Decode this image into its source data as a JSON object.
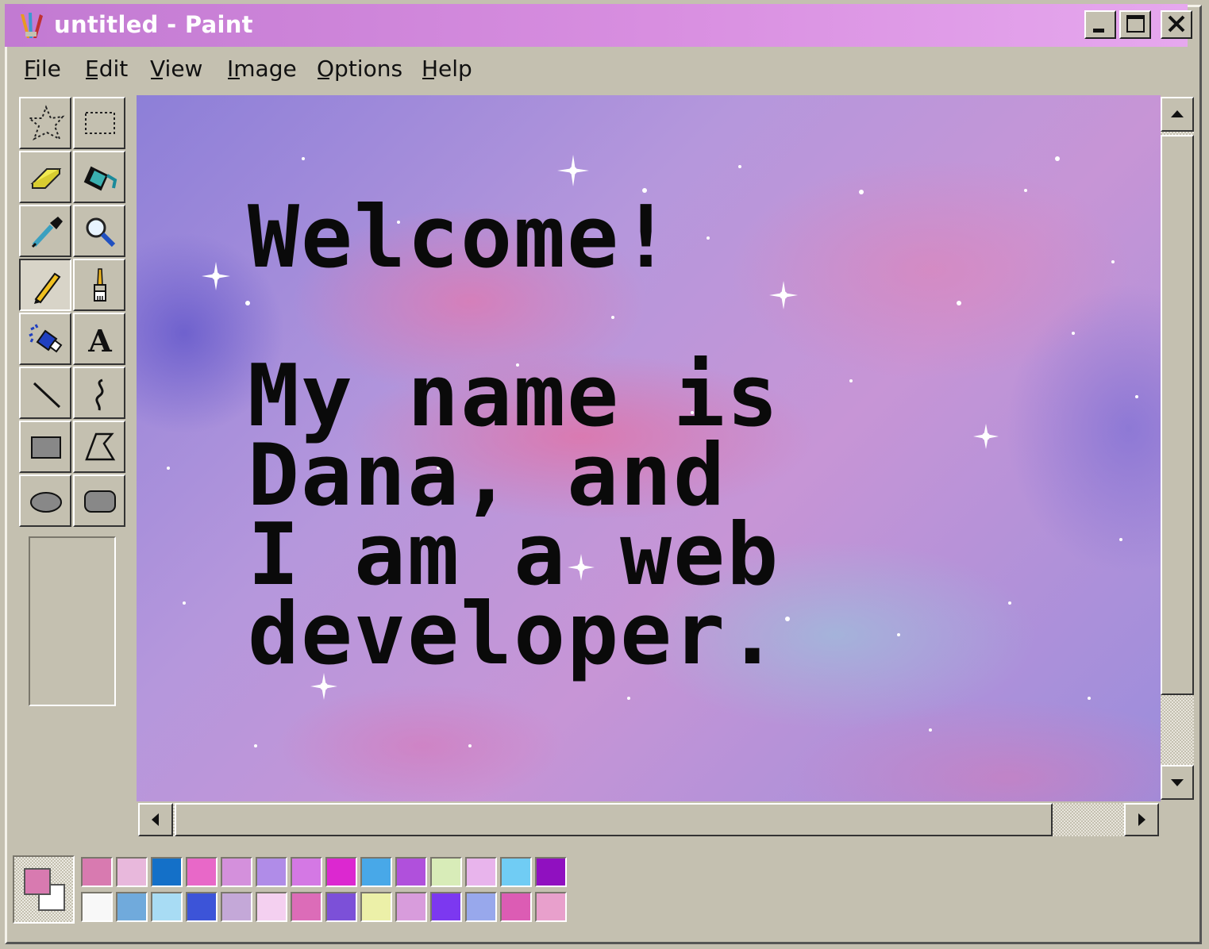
{
  "window": {
    "title": "untitled - Paint",
    "icons": {
      "app": "paint-app-icon",
      "minimize": "minimize-icon",
      "maximize": "maximize-icon",
      "close": "close-icon"
    }
  },
  "menu": [
    {
      "label": "File"
    },
    {
      "label": "Edit"
    },
    {
      "label": "View"
    },
    {
      "label": "Image"
    },
    {
      "label": "Options"
    },
    {
      "label": "Help"
    }
  ],
  "tools": [
    {
      "name": "free-form-select",
      "icon": "free-form-select-icon"
    },
    {
      "name": "rectangle-select",
      "icon": "rectangle-select-icon"
    },
    {
      "name": "eraser",
      "icon": "eraser-icon"
    },
    {
      "name": "fill",
      "icon": "paint-bucket-icon"
    },
    {
      "name": "pick-color",
      "icon": "eyedropper-icon"
    },
    {
      "name": "magnifier",
      "icon": "magnifier-icon"
    },
    {
      "name": "pencil",
      "icon": "pencil-icon",
      "selected": true
    },
    {
      "name": "brush",
      "icon": "brush-icon"
    },
    {
      "name": "airbrush",
      "icon": "airbrush-icon"
    },
    {
      "name": "text",
      "icon": "text-tool-icon",
      "glyph": "A"
    },
    {
      "name": "line",
      "icon": "line-icon"
    },
    {
      "name": "curve",
      "icon": "curve-icon"
    },
    {
      "name": "rectangle",
      "icon": "rectangle-icon"
    },
    {
      "name": "polygon",
      "icon": "polygon-icon"
    },
    {
      "name": "ellipse",
      "icon": "ellipse-icon"
    },
    {
      "name": "rounded-rectangle",
      "icon": "rounded-rectangle-icon"
    }
  ],
  "canvas": {
    "text": "Welcome!\n\nMy name is\nDana, and\nI am a web\ndeveloper."
  },
  "colors": {
    "foreground": "#d87ab0",
    "background": "#ffffff",
    "palette": [
      "#d87ab0",
      "#e8b8dc",
      "#1470c8",
      "#e868c8",
      "#d490dc",
      "#b08ce8",
      "#d478e4",
      "#dc28d0",
      "#48a8e8",
      "#b050dc",
      "#d8ecb8",
      "#e8b4ec",
      "#70ccf4",
      "#9010c0",
      "#f8f8f8",
      "#70aadc",
      "#a8dcf4",
      "#3c54d8",
      "#c4a8d8",
      "#f4d0f0",
      "#dc6cb8",
      "#7c50d8",
      "#ecf0a8",
      "#d89cdc",
      "#7c38f0",
      "#98a8ec",
      "#dc5cb4",
      "#e8a0cc"
    ]
  }
}
